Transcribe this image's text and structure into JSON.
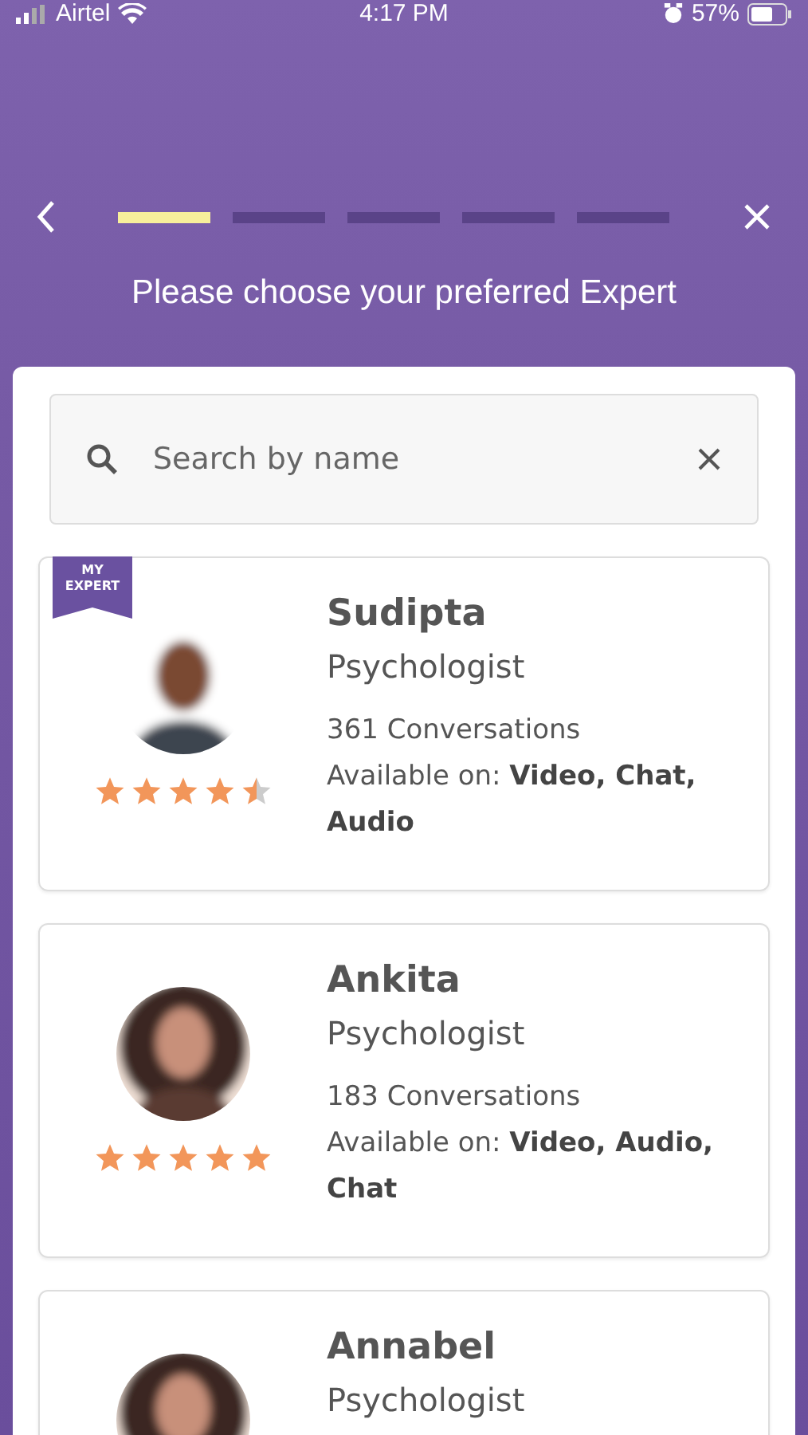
{
  "status_bar": {
    "carrier": "Airtel",
    "time": "4:17 PM",
    "battery": "57%"
  },
  "progress": [
    {
      "active": true
    },
    {
      "active": false
    },
    {
      "active": false
    },
    {
      "active": false
    },
    {
      "active": false
    }
  ],
  "title": "Please choose your preferred Expert",
  "search": {
    "placeholder": "Search by name"
  },
  "experts": [
    {
      "name": "Sudipta",
      "role": "Psychologist",
      "conversations": "361 Conversations",
      "availability": "Available on: **Video, Chat, Audio**",
      "badge": "MY EXPERT",
      "stars": 4.5,
      "kind": "picture"
    },
    {
      "name": "Ankita",
      "role": "Psychologist",
      "conversations": "183 Conversations",
      "availability": "Available on: **Video, Audio, Chat**",
      "stars": 5,
      "kind": "picture"
    },
    {
      "name": "Annabel",
      "role": "Psychologist",
      "kind": "picture"
    }
  ]
}
